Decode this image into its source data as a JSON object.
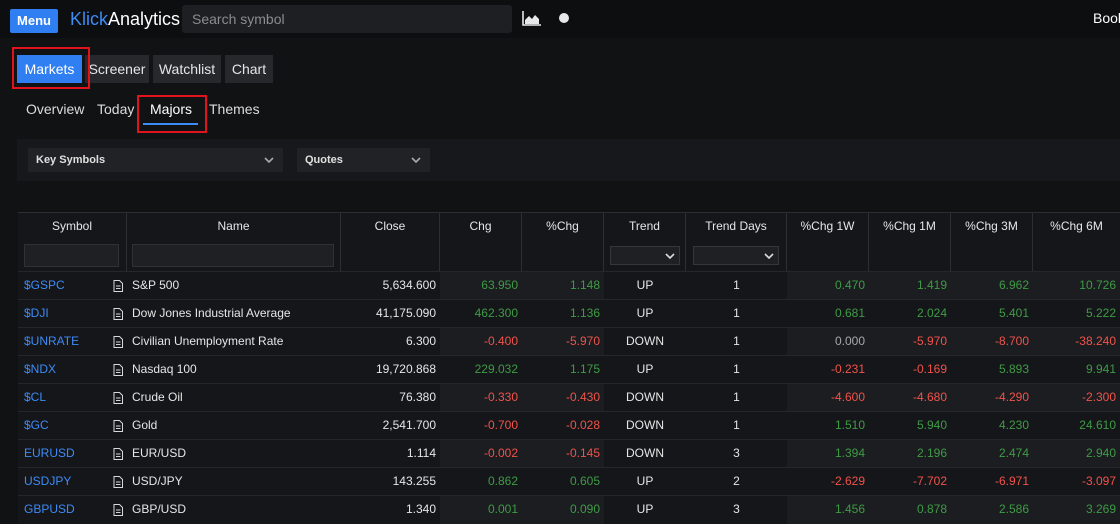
{
  "topbar": {
    "menu_label": "Menu",
    "logo_part1": "Klick",
    "logo_part2": "Analytics",
    "search_placeholder": "Search symbol",
    "right_text": "Book"
  },
  "main_tabs": [
    "Markets",
    "Screener",
    "Watchlist",
    "Chart"
  ],
  "sub_tabs": [
    "Overview",
    "Today",
    "Majors",
    "Themes"
  ],
  "filters": {
    "list_select": "Key Symbols",
    "view_select": "Quotes"
  },
  "columns": [
    "Symbol",
    "Name",
    "Close",
    "Chg",
    "%Chg",
    "Trend",
    "Trend Days",
    "%Chg 1W",
    "%Chg 1M",
    "%Chg 3M",
    "%Chg 6M"
  ],
  "rows": [
    {
      "symbol": "$GSPC",
      "name": "S&P 500",
      "close": "5,634.600",
      "chg": "63.950",
      "pchg": "1.148",
      "trend": "UP",
      "days": "1",
      "w1": "0.470",
      "m1": "1.419",
      "m3": "6.962",
      "m6": "10.726"
    },
    {
      "symbol": "$DJI",
      "name": "Dow Jones Industrial Average",
      "close": "41,175.090",
      "chg": "462.300",
      "pchg": "1.136",
      "trend": "UP",
      "days": "1",
      "w1": "0.681",
      "m1": "2.024",
      "m3": "5.401",
      "m6": "5.222"
    },
    {
      "symbol": "$UNRATE",
      "name": "Civilian Unemployment Rate",
      "close": "6.300",
      "chg": "-0.400",
      "pchg": "-5.970",
      "trend": "DOWN",
      "days": "1",
      "w1": "0.000",
      "m1": "-5.970",
      "m3": "-8.700",
      "m6": "-38.240"
    },
    {
      "symbol": "$NDX",
      "name": "Nasdaq 100",
      "close": "19,720.868",
      "chg": "229.032",
      "pchg": "1.175",
      "trend": "UP",
      "days": "1",
      "w1": "-0.231",
      "m1": "-0.169",
      "m3": "5.893",
      "m6": "9.941"
    },
    {
      "symbol": "$CL",
      "name": "Crude Oil",
      "close": "76.380",
      "chg": "-0.330",
      "pchg": "-0.430",
      "trend": "DOWN",
      "days": "1",
      "w1": "-4.600",
      "m1": "-4.680",
      "m3": "-4.290",
      "m6": "-2.300"
    },
    {
      "symbol": "$GC",
      "name": "Gold",
      "close": "2,541.700",
      "chg": "-0.700",
      "pchg": "-0.028",
      "trend": "DOWN",
      "days": "1",
      "w1": "1.510",
      "m1": "5.940",
      "m3": "4.230",
      "m6": "24.610"
    },
    {
      "symbol": "EURUSD",
      "name": "EUR/USD",
      "close": "1.114",
      "chg": "-0.002",
      "pchg": "-0.145",
      "trend": "DOWN",
      "days": "3",
      "w1": "1.394",
      "m1": "2.196",
      "m3": "2.474",
      "m6": "2.940"
    },
    {
      "symbol": "USDJPY",
      "name": "USD/JPY",
      "close": "143.255",
      "chg": "0.862",
      "pchg": "0.605",
      "trend": "UP",
      "days": "2",
      "w1": "-2.629",
      "m1": "-7.702",
      "m3": "-6.971",
      "m6": "-3.097"
    },
    {
      "symbol": "GBPUSD",
      "name": "GBP/USD",
      "close": "1.340",
      "chg": "0.001",
      "pchg": "0.090",
      "trend": "UP",
      "days": "3",
      "w1": "1.456",
      "m1": "0.878",
      "m3": "2.586",
      "m6": "3.269"
    }
  ],
  "colors": {
    "accent": "#2f7ff2",
    "positive": "#3f9b45",
    "negative": "#f0534a",
    "highlight_box": "#e0141c"
  }
}
